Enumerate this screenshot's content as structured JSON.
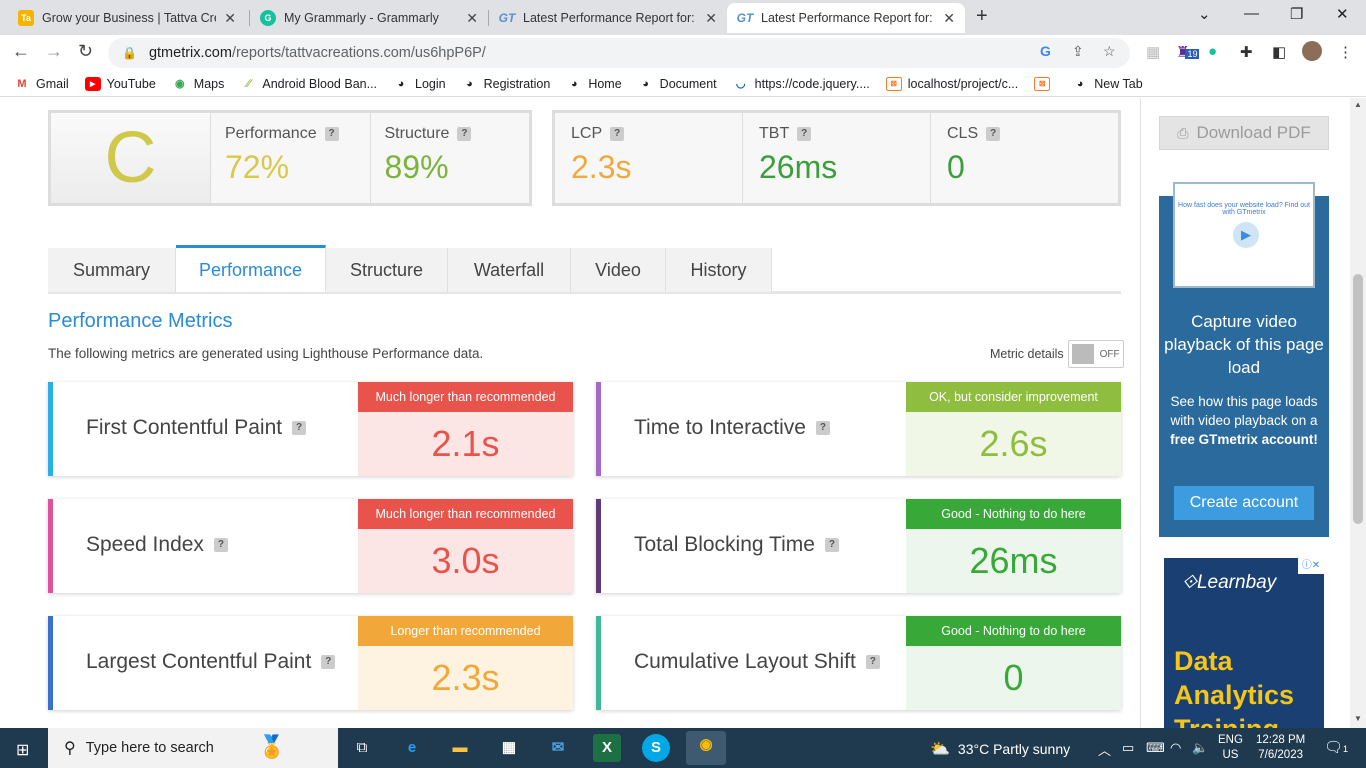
{
  "browser": {
    "tabs": [
      {
        "title": "Grow your Business | Tattva Creat",
        "icon": "tattva-favicon",
        "color": "#f4b400",
        "active": false
      },
      {
        "title": "My Grammarly - Grammarly",
        "icon": "grammarly-favicon",
        "color": "#15c39a",
        "active": false
      },
      {
        "title": "Latest Performance Report for: ht",
        "icon": "gtmetrix-favicon",
        "color": "#5a8fd0",
        "active": false
      },
      {
        "title": "Latest Performance Report for: ht",
        "icon": "gtmetrix-favicon",
        "color": "#5a8fd0",
        "active": true
      }
    ],
    "url_domain": "gtmetrix.com",
    "url_path": "/reports/tattvacreations.com/us6hpP6P/",
    "extension_badge": "19",
    "bookmarks": [
      "Gmail",
      "YouTube",
      "Maps",
      "Android Blood Ban...",
      "Login",
      "Registration",
      "Home",
      "Document",
      "https://code.jquery....",
      "localhost/project/c...",
      "",
      "New Tab"
    ]
  },
  "report": {
    "grade": "C",
    "performance_label": "Performance",
    "performance_value": "72%",
    "structure_label": "Structure",
    "structure_value": "89%",
    "lcp_label": "LCP",
    "lcp_value": "2.3s",
    "tbt_label": "TBT",
    "tbt_value": "26ms",
    "cls_label": "CLS",
    "cls_value": "0",
    "help_mark": "?",
    "tabs": [
      "Summary",
      "Performance",
      "Structure",
      "Waterfall",
      "Video",
      "History"
    ],
    "active_tab": "Performance",
    "section_title": "Performance Metrics",
    "section_subtitle": "The following metrics are generated using Lighthouse Performance data.",
    "metric_details_label": "Metric details",
    "metric_details_toggle": "OFF",
    "metrics": [
      {
        "name": "First Contentful Paint",
        "value": "2.1s",
        "status": "Much longer than recommended"
      },
      {
        "name": "Time to Interactive",
        "value": "2.6s",
        "status": "OK, but consider improvement"
      },
      {
        "name": "Speed Index",
        "value": "3.0s",
        "status": "Much longer than recommended"
      },
      {
        "name": "Total Blocking Time",
        "value": "26ms",
        "status": "Good - Nothing to do here"
      },
      {
        "name": "Largest Contentful Paint",
        "value": "2.3s",
        "status": "Longer than recommended"
      },
      {
        "name": "Cumulative Layout Shift",
        "value": "0",
        "status": "Good - Nothing to do here"
      }
    ]
  },
  "sidebar": {
    "download_pdf": "Download PDF",
    "promo_thumb_text": "How fast does your website load? Find out with GTmetrix",
    "promo_title": "Capture video playback of this page load",
    "promo_text_1": "See how this page loads with video playback on a",
    "promo_text_bold": "free GTmetrix account!",
    "promo_button": "Create account",
    "ad_logo": "Learnbay",
    "ad_text": "Data Analytics Training"
  },
  "taskbar": {
    "search_placeholder": "Type here to search",
    "weather": "33°C  Partly sunny",
    "lang_1": "ENG",
    "lang_2": "US",
    "time": "12:28 PM",
    "date": "7/6/2023",
    "notification_count": "1"
  },
  "colors": {
    "accent": "#2a8bd6",
    "grade_c": "#cfc84b",
    "perf_value": "#d9c84a",
    "structure_value": "#7bb33b",
    "lcp_value": "#f1a83c",
    "good_value": "#3a9f3a",
    "bad": "#e8544c",
    "warn": "#f2a73b",
    "ok": "#8fbd3f",
    "good": "#38a838"
  }
}
